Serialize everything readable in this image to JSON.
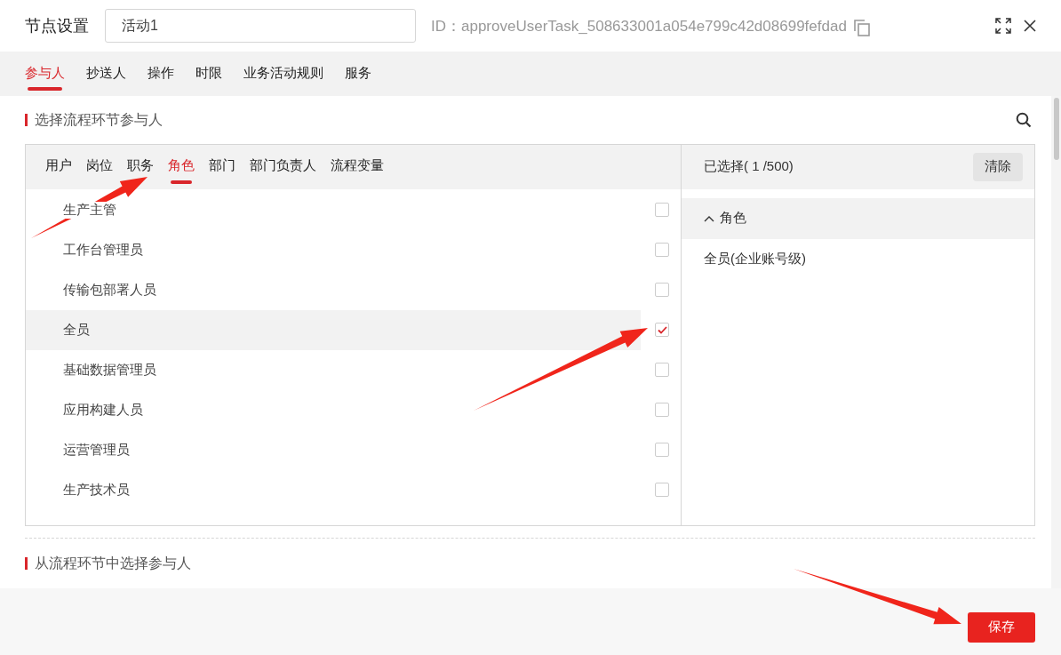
{
  "dialog": {
    "title": "节点设置",
    "name_value": "活动1",
    "id_text": "ID：approveUserTask_508633001a054e799c42d08699fefdad"
  },
  "tabs": [
    {
      "label": "参与人",
      "selected": true
    },
    {
      "label": "抄送人",
      "selected": false
    },
    {
      "label": "操作",
      "selected": false
    },
    {
      "label": "时限",
      "selected": false
    },
    {
      "label": "业务活动规则",
      "selected": false
    },
    {
      "label": "服务",
      "selected": false
    }
  ],
  "section_1": {
    "title": "选择流程环节参与人",
    "sub_tabs": [
      {
        "label": "用户",
        "selected": false
      },
      {
        "label": "岗位",
        "selected": false
      },
      {
        "label": "职务",
        "selected": false
      },
      {
        "label": "角色",
        "selected": true
      },
      {
        "label": "部门",
        "selected": false
      },
      {
        "label": "部门负责人",
        "selected": false
      },
      {
        "label": "流程变量",
        "selected": false
      }
    ],
    "roles": [
      {
        "name": "生产主管",
        "checked": false,
        "highlighted": false
      },
      {
        "name": "工作台管理员",
        "checked": false,
        "highlighted": false
      },
      {
        "name": "传输包部署人员",
        "checked": false,
        "highlighted": false
      },
      {
        "name": "全员",
        "checked": true,
        "highlighted": true
      },
      {
        "name": "基础数据管理员",
        "checked": false,
        "highlighted": false
      },
      {
        "name": "应用构建人员",
        "checked": false,
        "highlighted": false
      },
      {
        "name": "运营管理员",
        "checked": false,
        "highlighted": false
      },
      {
        "name": "生产技术员",
        "checked": false,
        "highlighted": false
      }
    ],
    "selected_panel": {
      "summary": "已选择( 1 /500)",
      "clear_button": "清除",
      "groups": [
        {
          "label": "角色",
          "expanded": true,
          "items": [
            "全员(企业账号级)"
          ]
        }
      ]
    }
  },
  "section_2": {
    "title": "从流程环节中选择参与人"
  },
  "footer": {
    "save_button": "保存"
  }
}
